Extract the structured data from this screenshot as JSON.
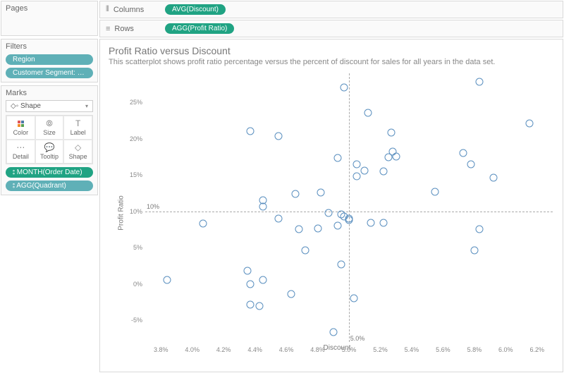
{
  "shelves": {
    "columns_label": "Columns",
    "rows_label": "Rows",
    "columns_pill": "AVG(Discount)",
    "rows_pill": "AGG(Profit Ratio)"
  },
  "pages": {
    "title": "Pages"
  },
  "filters": {
    "title": "Filters",
    "items": [
      "Region",
      "Customer Segment: Small Busin..."
    ]
  },
  "marks": {
    "title": "Marks",
    "type_label": "Shape",
    "cards": [
      {
        "label": "Color"
      },
      {
        "label": "Size"
      },
      {
        "label": "Label"
      },
      {
        "label": "Detail"
      },
      {
        "label": "Tooltip"
      },
      {
        "label": "Shape"
      }
    ],
    "pills": [
      {
        "label": "MONTH(Order Date)",
        "cls": "pill-green"
      },
      {
        "label": "AGG(Quadrant)",
        "cls": "pill-teal"
      }
    ]
  },
  "viz": {
    "title": "Profit Ratio versus Discount",
    "subtitle": "This scatterplot shows profit ratio percentage versus the percent of discount for sales for all years in the data set.",
    "xlabel": "Discount",
    "ylabel": "Profit Ratio",
    "ref_h_label": "10%",
    "ref_v_label": "5.0%"
  },
  "chart_data": {
    "type": "scatter",
    "xlabel": "Discount",
    "ylabel": "Profit Ratio",
    "x_range": [
      3.7,
      6.3
    ],
    "y_range": [
      -8,
      29
    ],
    "x_ticks": [
      3.8,
      4.0,
      4.2,
      4.4,
      4.6,
      4.8,
      5.0,
      5.2,
      5.4,
      5.6,
      5.8,
      6.0,
      6.2
    ],
    "y_ticks": [
      -5,
      0,
      5,
      10,
      15,
      20,
      25
    ],
    "x_tick_labels": [
      "3.8%",
      "4.0%",
      "4.2%",
      "4.4%",
      "4.6%",
      "4.8%",
      "5.0%",
      "5.2%",
      "5.4%",
      "5.6%",
      "5.8%",
      "6.0%",
      "6.2%"
    ],
    "y_tick_labels": [
      "-5%",
      "0%",
      "5%",
      "10%",
      "15%",
      "20%",
      "25%"
    ],
    "ref_lines": {
      "h": 10,
      "v": 5.0
    },
    "points": [
      {
        "x": 3.84,
        "y": 0.5
      },
      {
        "x": 4.07,
        "y": 8.3
      },
      {
        "x": 4.37,
        "y": 21.0
      },
      {
        "x": 4.35,
        "y": 1.8
      },
      {
        "x": 4.37,
        "y": -2.9
      },
      {
        "x": 4.37,
        "y": 0.0
      },
      {
        "x": 4.43,
        "y": -3.0
      },
      {
        "x": 4.45,
        "y": 10.6
      },
      {
        "x": 4.45,
        "y": 0.5
      },
      {
        "x": 4.45,
        "y": 11.5
      },
      {
        "x": 4.55,
        "y": 20.4
      },
      {
        "x": 4.55,
        "y": 9.0
      },
      {
        "x": 4.63,
        "y": -1.4
      },
      {
        "x": 4.66,
        "y": 12.4
      },
      {
        "x": 4.68,
        "y": 7.5
      },
      {
        "x": 4.72,
        "y": 4.6
      },
      {
        "x": 4.8,
        "y": 7.6
      },
      {
        "x": 4.82,
        "y": 12.6
      },
      {
        "x": 4.87,
        "y": 9.8
      },
      {
        "x": 4.93,
        "y": 17.3
      },
      {
        "x": 4.93,
        "y": 8.0
      },
      {
        "x": 4.95,
        "y": 9.6
      },
      {
        "x": 4.95,
        "y": 2.7
      },
      {
        "x": 4.97,
        "y": 27.1
      },
      {
        "x": 4.97,
        "y": 9.3
      },
      {
        "x": 5.0,
        "y": 8.8
      },
      {
        "x": 5.0,
        "y": 9.0
      },
      {
        "x": 4.9,
        "y": -6.6
      },
      {
        "x": 5.03,
        "y": -2.0
      },
      {
        "x": 5.05,
        "y": 16.5
      },
      {
        "x": 5.05,
        "y": 14.8
      },
      {
        "x": 5.12,
        "y": 23.6
      },
      {
        "x": 5.14,
        "y": 8.4
      },
      {
        "x": 5.1,
        "y": 15.6
      },
      {
        "x": 5.22,
        "y": 15.5
      },
      {
        "x": 5.22,
        "y": 8.4
      },
      {
        "x": 5.25,
        "y": 17.4
      },
      {
        "x": 5.27,
        "y": 20.8
      },
      {
        "x": 5.28,
        "y": 18.2
      },
      {
        "x": 5.3,
        "y": 17.5
      },
      {
        "x": 5.55,
        "y": 12.7
      },
      {
        "x": 5.73,
        "y": 18.0
      },
      {
        "x": 5.78,
        "y": 16.5
      },
      {
        "x": 5.8,
        "y": 4.6
      },
      {
        "x": 5.83,
        "y": 7.5
      },
      {
        "x": 5.83,
        "y": 27.8
      },
      {
        "x": 5.92,
        "y": 14.6
      },
      {
        "x": 6.15,
        "y": 22.1
      }
    ]
  }
}
